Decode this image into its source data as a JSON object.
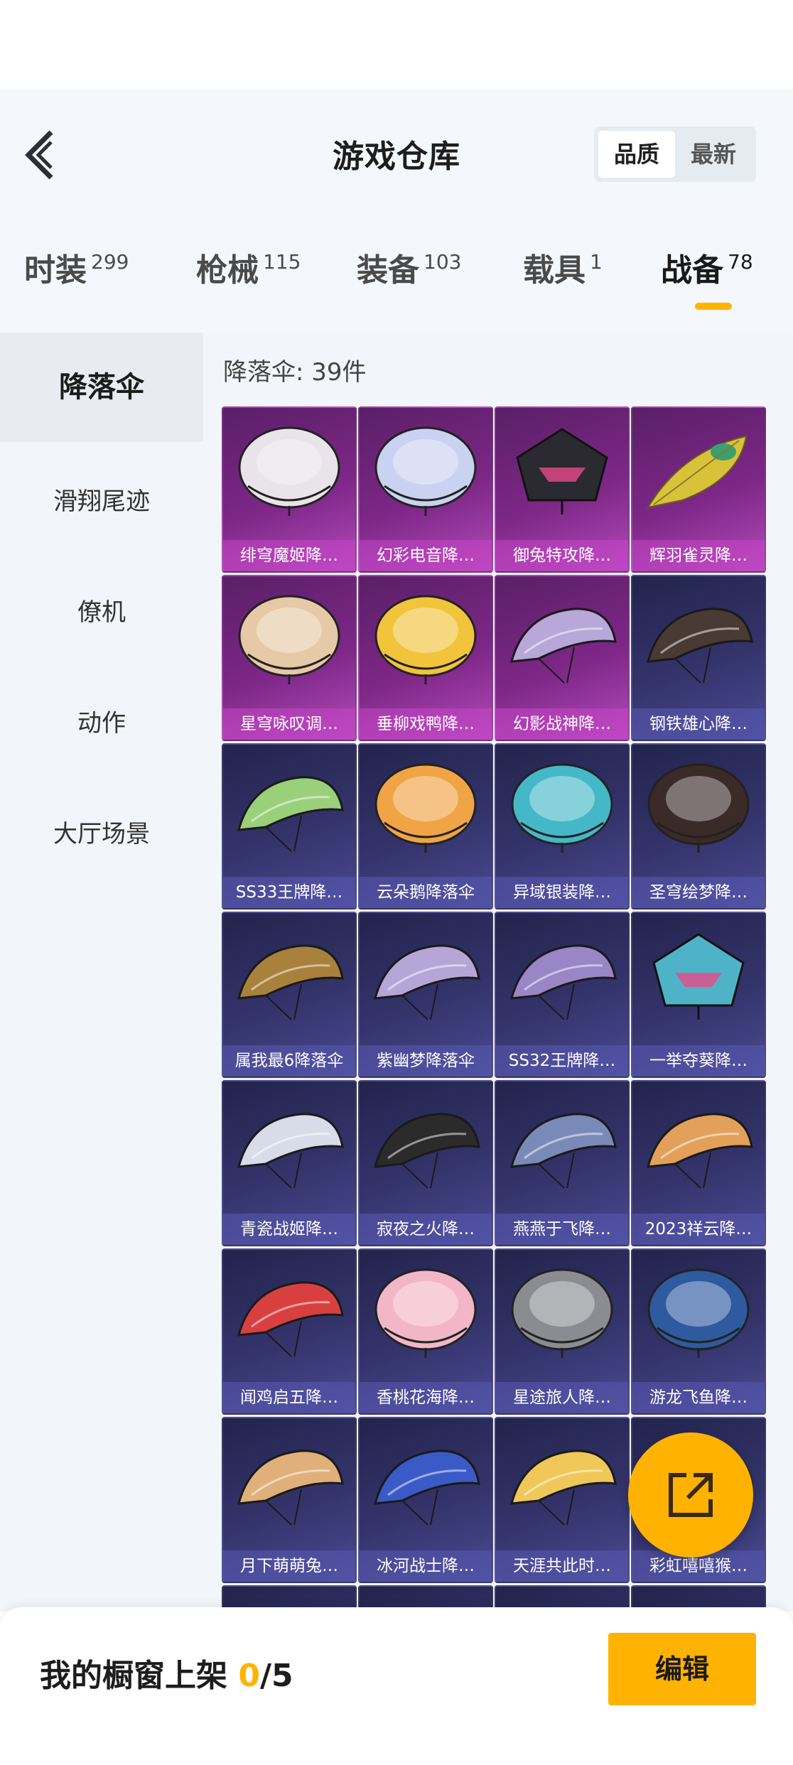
{
  "header": {
    "title": "游戏仓库",
    "sort_options": [
      "品质",
      "最新"
    ]
  },
  "tabs": [
    {
      "label": "时装",
      "count": "299"
    },
    {
      "label": "枪械",
      "count": "115"
    },
    {
      "label": "装备",
      "count": "103"
    },
    {
      "label": "载具",
      "count": "1"
    },
    {
      "label": "战备",
      "count": "78"
    }
  ],
  "active_tab": "战备",
  "sidebar": {
    "items": [
      "降落伞",
      "滑翔尾迹",
      "僚机",
      "动作",
      "大厅场景"
    ]
  },
  "content": {
    "count_label": "降落伞: 39件",
    "items": [
      {
        "name": "绯穹魔姬降…",
        "quality": "purple",
        "icon": "parachute-round",
        "color": "#e9e4ea"
      },
      {
        "name": "幻彩电音降…",
        "quality": "purple",
        "icon": "parachute-round",
        "color": "#c9d2f0"
      },
      {
        "name": "御兔特攻降…",
        "quality": "purple",
        "icon": "parachute-square",
        "color": "#2a2a30"
      },
      {
        "name": "辉羽雀灵降…",
        "quality": "purple",
        "icon": "parachute-feather",
        "color": "#d8c23a"
      },
      {
        "name": "星穹咏叹调…",
        "quality": "purple",
        "icon": "parachute-round",
        "color": "#e6c9a6"
      },
      {
        "name": "垂柳戏鸭降…",
        "quality": "purple",
        "icon": "parachute-round",
        "color": "#f2c43c"
      },
      {
        "name": "幻影战神降…",
        "quality": "purple",
        "icon": "parachute-wing",
        "color": "#b8a7d8"
      },
      {
        "name": "钢铁雄心降…",
        "quality": "blue",
        "icon": "parachute-wing",
        "color": "#4a3a34"
      },
      {
        "name": "SS33王牌降…",
        "quality": "blue",
        "icon": "parachute-wing",
        "color": "#9ad07a"
      },
      {
        "name": "云朵鹅降落伞",
        "quality": "blue",
        "icon": "parachute-round",
        "color": "#f0a446"
      },
      {
        "name": "异域银装降…",
        "quality": "blue",
        "icon": "parachute-round",
        "color": "#45b8c8"
      },
      {
        "name": "圣穹绘梦降…",
        "quality": "blue",
        "icon": "parachute-round",
        "color": "#3a2a28"
      },
      {
        "name": "属我最6降落伞",
        "quality": "blue",
        "icon": "parachute-wing",
        "color": "#a8813c"
      },
      {
        "name": "紫幽梦降落伞",
        "quality": "blue",
        "icon": "parachute-wing",
        "color": "#b6a6d8"
      },
      {
        "name": "SS32王牌降…",
        "quality": "blue",
        "icon": "parachute-wing",
        "color": "#9a86c6"
      },
      {
        "name": "一举夺葵降…",
        "quality": "blue",
        "icon": "parachute-square",
        "color": "#4fb3c8"
      },
      {
        "name": "青瓷战姬降…",
        "quality": "blue",
        "icon": "parachute-wing",
        "color": "#d8dce8"
      },
      {
        "name": "寂夜之火降…",
        "quality": "blue",
        "icon": "parachute-wing",
        "color": "#2b2b2b"
      },
      {
        "name": "燕燕于飞降…",
        "quality": "blue",
        "icon": "parachute-wing",
        "color": "#7a8ab8"
      },
      {
        "name": "2023祥云降…",
        "quality": "blue",
        "icon": "parachute-wing",
        "color": "#e3a05a"
      },
      {
        "name": "闻鸡启五降…",
        "quality": "blue",
        "icon": "parachute-wing",
        "color": "#d84040"
      },
      {
        "name": "香桃花海降…",
        "quality": "blue",
        "icon": "parachute-round",
        "color": "#f2b6c8"
      },
      {
        "name": "星途旅人降…",
        "quality": "blue",
        "icon": "parachute-round",
        "color": "#8a8c92"
      },
      {
        "name": "游龙飞鱼降…",
        "quality": "blue",
        "icon": "parachute-round",
        "color": "#2e5aa0"
      },
      {
        "name": "月下萌萌兔…",
        "quality": "blue",
        "icon": "parachute-wing",
        "color": "#e0b07a"
      },
      {
        "name": "冰河战士降…",
        "quality": "blue",
        "icon": "parachute-wing",
        "color": "#3a5ac8"
      },
      {
        "name": "天涯共此时…",
        "quality": "blue",
        "icon": "parachute-wing",
        "color": "#f0c85a"
      },
      {
        "name": "彩虹嘻嘻猴…",
        "quality": "blue",
        "icon": "parachute-wing",
        "color": "#8ac84a"
      },
      {
        "name": "",
        "quality": "blue",
        "icon": "parachute-wing",
        "color": "#4a4a7a"
      },
      {
        "name": "",
        "quality": "blue",
        "icon": "parachute-wing",
        "color": "#4a4a7a"
      },
      {
        "name": "",
        "quality": "blue",
        "icon": "parachute-wing",
        "color": "#4a4a7a"
      },
      {
        "name": "",
        "quality": "blue",
        "icon": "parachute-wing",
        "color": "#4a4a7a"
      }
    ]
  },
  "fab": {
    "icon": "share-icon"
  },
  "bottom": {
    "label": "我的橱窗上架 ",
    "current": "0",
    "total": "/5",
    "edit_label": "编辑"
  },
  "colors": {
    "accent": "#ffb300",
    "rare_purple": "#8a2f92",
    "epic_blue": "#3a3a7a"
  }
}
